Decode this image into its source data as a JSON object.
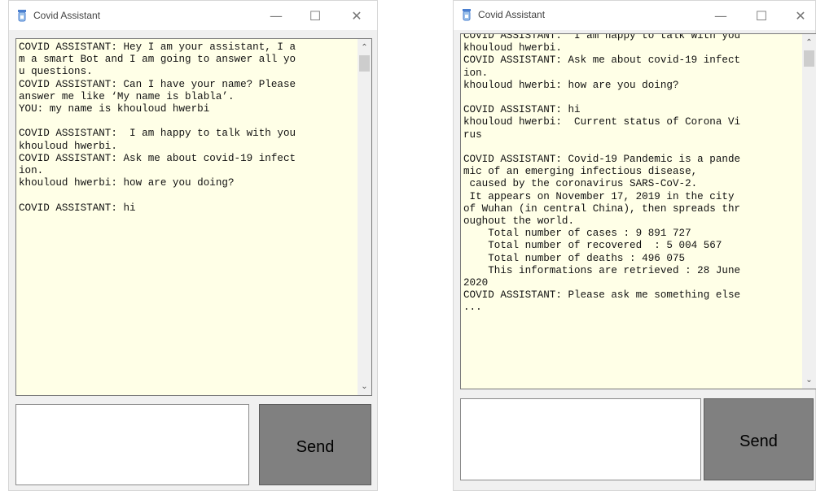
{
  "windows": [
    {
      "title": "Covid Assistant",
      "controls": {
        "minimize": "—",
        "maximize": "☐",
        "close": "✕"
      },
      "chat_lines": [
        "COVID ASSISTANT: Hey I am your assistant, I a",
        "m a smart Bot and I am going to answer all yo",
        "u questions.",
        "COVID ASSISTANT: Can I have your name? Please",
        "answer me like ‘My name is blabla’.",
        "YOU: my name is khouloud hwerbi",
        "",
        "COVID ASSISTANT:  I am happy to talk with you",
        "khouloud hwerbi.",
        "COVID ASSISTANT: Ask me about covid-19 infect",
        "ion.",
        "khouloud hwerbi: how are you doing?",
        "",
        "COVID ASSISTANT: hi"
      ],
      "scroll": {
        "up": "⌃",
        "down": "⌄"
      },
      "input_value": "",
      "send_label": "Send"
    },
    {
      "title": "Covid Assistant",
      "controls": {
        "minimize": "—",
        "maximize": "☐",
        "close": "✕"
      },
      "chat_lines": [
        "COVID ASSISTANT:  I am happy to talk with you",
        "khouloud hwerbi.",
        "COVID ASSISTANT: Ask me about covid-19 infect",
        "ion.",
        "khouloud hwerbi: how are you doing?",
        "",
        "COVID ASSISTANT: hi",
        "khouloud hwerbi:  Current status of Corona Vi",
        "rus",
        "",
        "COVID ASSISTANT: Covid-19 Pandemic is a pande",
        "mic of an emerging infectious disease,",
        " caused by the coronavirus SARS-CoV-2.",
        " It appears on November 17, 2019 in the city",
        "of Wuhan (in central China), then spreads thr",
        "oughout the world.",
        "    Total number of cases : 9 891 727",
        "    Total number of recovered  : 5 004 567",
        "    Total number of deaths : 496 075",
        "    This informations are retrieved : 28 June",
        "2020",
        "COVID ASSISTANT: Please ask me something else",
        "..."
      ],
      "scroll": {
        "up": "⌃",
        "down": "⌄"
      },
      "input_value": "",
      "send_label": "Send"
    }
  ]
}
